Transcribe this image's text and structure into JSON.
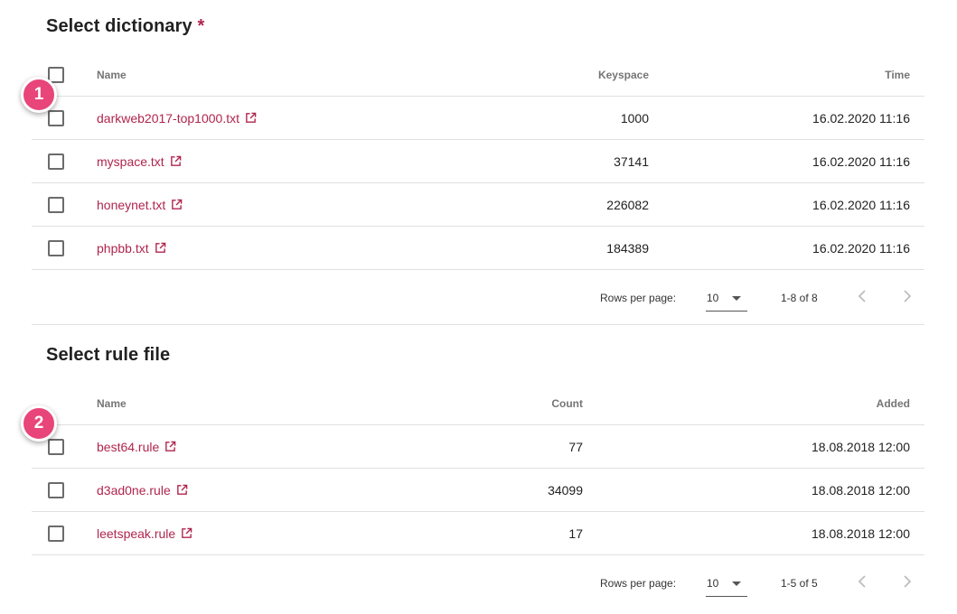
{
  "dictionary": {
    "title": "Select dictionary",
    "required_mark": "*",
    "columns": {
      "name": "Name",
      "value": "Keyspace",
      "time": "Time"
    },
    "rows": [
      {
        "name": "darkweb2017-top1000.txt",
        "value": "1000",
        "time": "16.02.2020 11:16"
      },
      {
        "name": "myspace.txt",
        "value": "37141",
        "time": "16.02.2020 11:16"
      },
      {
        "name": "honeynet.txt",
        "value": "226082",
        "time": "16.02.2020 11:16"
      },
      {
        "name": "phpbb.txt",
        "value": "184389",
        "time": "16.02.2020 11:16"
      }
    ],
    "footer": {
      "rows_per_page_label": "Rows per page:",
      "rows_per_page": "10",
      "range": "1-8 of 8"
    },
    "badge": "1"
  },
  "rules": {
    "title": "Select rule file",
    "columns": {
      "name": "Name",
      "value": "Count",
      "time": "Added"
    },
    "rows": [
      {
        "name": "best64.rule",
        "value": "77",
        "time": "18.08.2018 12:00"
      },
      {
        "name": "d3ad0ne.rule",
        "value": "34099",
        "time": "18.08.2018 12:00"
      },
      {
        "name": "leetspeak.rule",
        "value": "17",
        "time": "18.08.2018 12:00"
      }
    ],
    "footer": {
      "rows_per_page_label": "Rows per page:",
      "rows_per_page": "10",
      "range": "1-5 of 5"
    },
    "badge": "2"
  },
  "colors": {
    "accent": "#b0254e",
    "badge": "#e8457a",
    "divider": "#e0e0e0",
    "icon_disabled": "#bdbdbd"
  },
  "icons": {
    "external": "external-link-icon",
    "prev": "chevron-left-icon",
    "next": "chevron-right-icon",
    "dropdown": "caret-down-icon"
  }
}
